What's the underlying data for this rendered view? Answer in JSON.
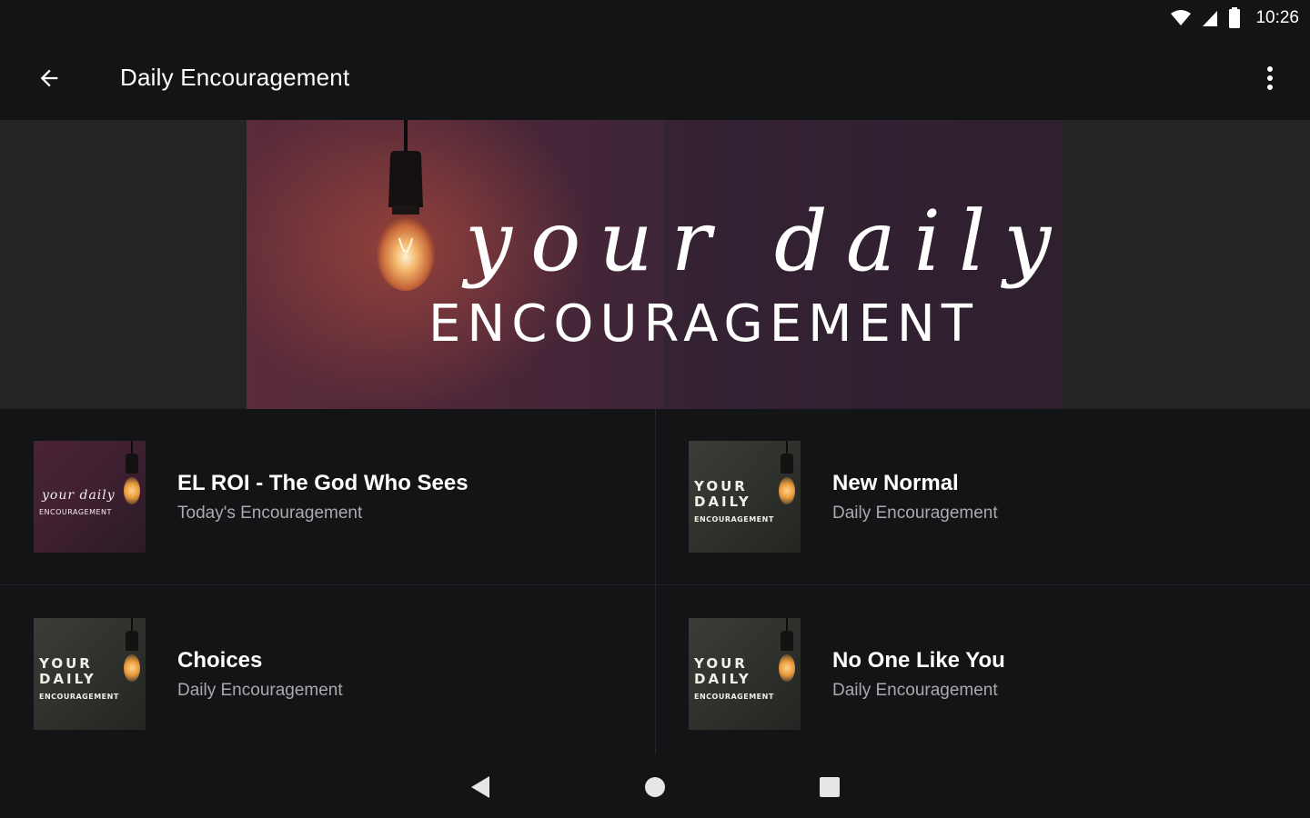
{
  "status_bar": {
    "time": "10:26",
    "icons": [
      "wifi-icon",
      "cellular-signal-icon",
      "battery-icon"
    ]
  },
  "app_bar": {
    "title": "Daily Encouragement",
    "back_icon": "arrow-back-icon",
    "menu_icon": "more-vert-icon"
  },
  "banner": {
    "script_text": "your daily",
    "caps_text": "ENCOURAGEMENT"
  },
  "episodes": [
    {
      "title": "EL ROI - The God Who Sees",
      "subtitle": "Today's Encouragement",
      "thumb_style": "script",
      "thumb_lines": [
        "your daily",
        "ENCOURAGEMENT"
      ]
    },
    {
      "title": "New Normal",
      "subtitle": "Daily Encouragement",
      "thumb_style": "block",
      "thumb_lines": [
        "YOUR",
        "DAILY",
        "ENCOURAGEMENT"
      ]
    },
    {
      "title": "Choices",
      "subtitle": "Daily Encouragement",
      "thumb_style": "block",
      "thumb_lines": [
        "YOUR",
        "DAILY",
        "ENCOURAGEMENT"
      ]
    },
    {
      "title": "No One Like You",
      "subtitle": "Daily Encouragement",
      "thumb_style": "block",
      "thumb_lines": [
        "YOUR",
        "DAILY",
        "ENCOURAGEMENT"
      ]
    }
  ],
  "nav_bar": {
    "icons": [
      "nav-back-icon",
      "nav-home-icon",
      "nav-recents-icon"
    ]
  },
  "colors": {
    "background": "#131416",
    "app_bar": "#131416",
    "banner_side": "#242424",
    "subtitle": "#a9aaad"
  }
}
